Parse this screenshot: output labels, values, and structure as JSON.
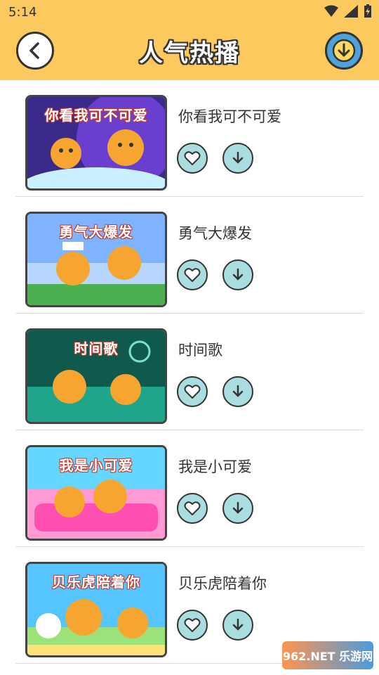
{
  "status_bar": {
    "time": "5:14"
  },
  "header": {
    "title": "人气热播"
  },
  "songs": [
    {
      "title": "你看我可不可爱",
      "thumb_label": "你看我可不可爱",
      "colors": [
        "#3b2a8a",
        "#6a3fcf",
        "#c8f0ff"
      ]
    },
    {
      "title": "勇气大爆发",
      "thumb_label": "勇气大爆发",
      "colors": [
        "#7fb2ff",
        "#b6d6ff",
        "#4caf50"
      ]
    },
    {
      "title": "时间歌",
      "thumb_label": "时间歌",
      "colors": [
        "#0f5a4d",
        "#1fa58a",
        "#7fe0c8"
      ]
    },
    {
      "title": "我是小可爱",
      "thumb_label": "我是小可爱",
      "colors": [
        "#64d6ff",
        "#ff9ad5",
        "#ff4fb2"
      ]
    },
    {
      "title": "贝乐虎陪着你",
      "thumb_label": "贝乐虎陪着你",
      "colors": [
        "#56c4ff",
        "#9be27a",
        "#ffe17a"
      ]
    }
  ],
  "watermark": {
    "text": "962.NET 乐游网"
  }
}
